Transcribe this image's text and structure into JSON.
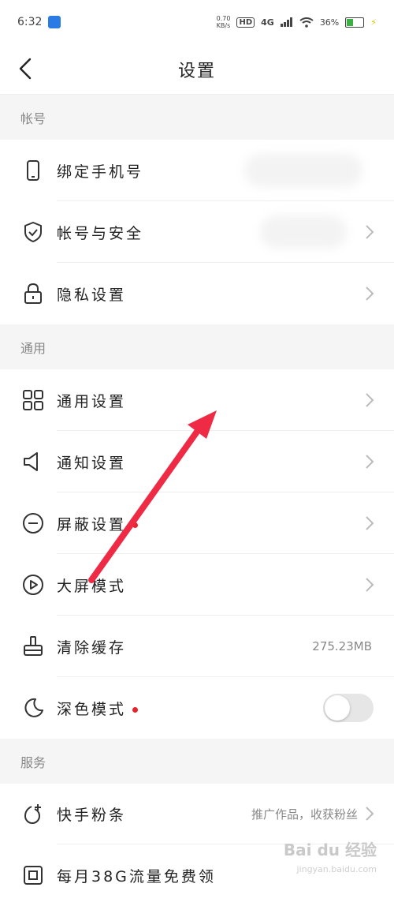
{
  "status_bar": {
    "time": "6:32",
    "net_speed": "0.70\nKB/s",
    "hd": "HD",
    "network": "4G",
    "battery": "36%"
  },
  "header": {
    "title": "设置"
  },
  "sections": [
    {
      "title": "帐号"
    },
    {
      "title": "通用"
    },
    {
      "title": "服务"
    }
  ],
  "items": {
    "bind_phone": {
      "label": "绑定手机号",
      "icon": "phone-icon"
    },
    "account_security": {
      "label": "帐号与安全",
      "icon": "shield-icon"
    },
    "privacy": {
      "label": "隐私设置",
      "icon": "lock-icon"
    },
    "general": {
      "label": "通用设置",
      "icon": "grid-icon"
    },
    "notification": {
      "label": "通知设置",
      "icon": "speaker-icon"
    },
    "block": {
      "label": "屏蔽设置",
      "icon": "minus-circle-icon"
    },
    "bigscreen": {
      "label": "大屏模式",
      "icon": "play-icon"
    },
    "clear_cache": {
      "label": "清除缓存",
      "icon": "brush-icon",
      "value": "275.23MB"
    },
    "dark_mode": {
      "label": "深色模式",
      "icon": "moon-icon",
      "toggle_on": false
    },
    "fans": {
      "label": "快手粉条",
      "icon": "fans-icon",
      "value": "推广作品，收获粉丝"
    },
    "data_plan": {
      "label": "每月38G流量免费领",
      "icon": "sim-icon"
    }
  },
  "watermark": {
    "brand": "Bai du 经验",
    "url": "jingyan.baidu.com"
  },
  "colors": {
    "accent_red": "#e5242b",
    "arrow": "#ee2a45",
    "section_bg": "#f5f5f5"
  }
}
